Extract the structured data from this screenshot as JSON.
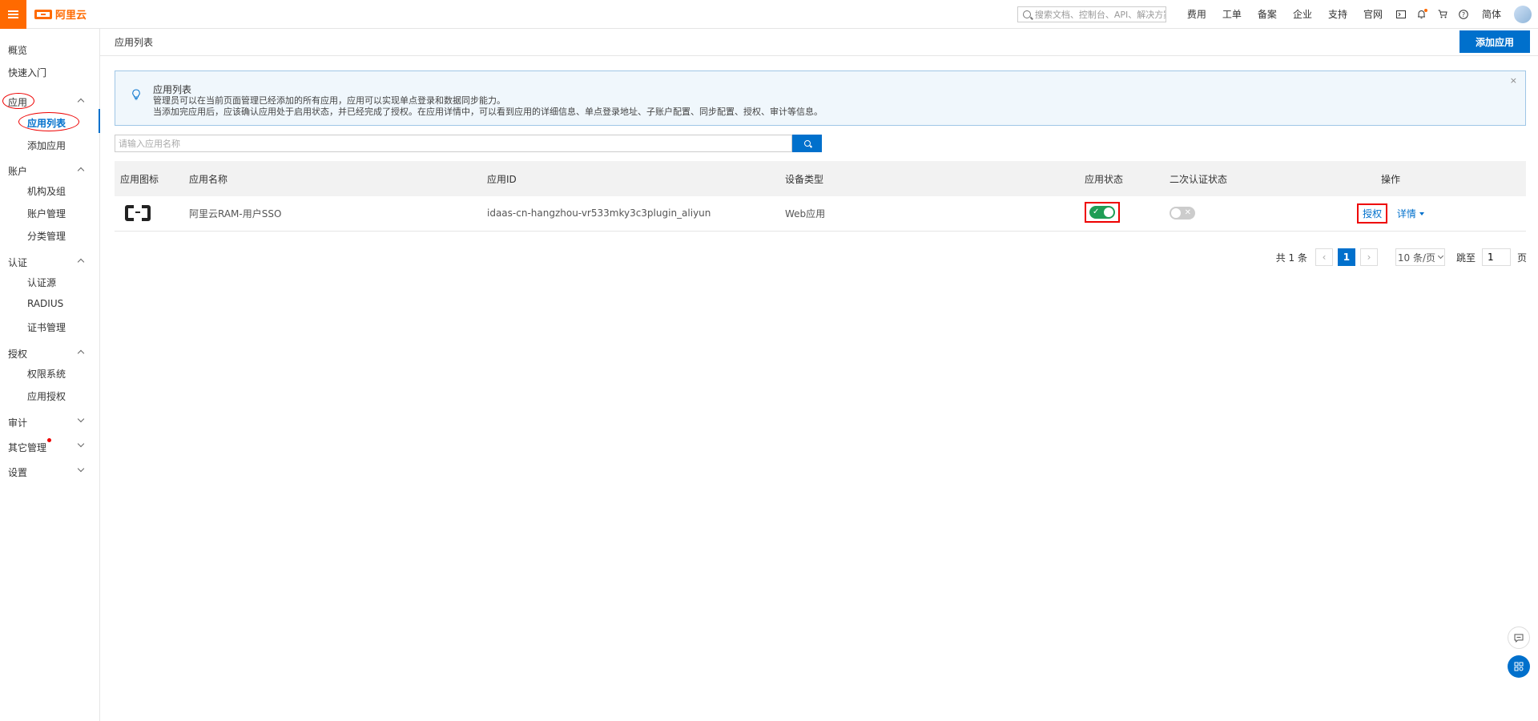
{
  "topbar": {
    "brand": "阿里云",
    "search_placeholder": "搜索文档、控制台、API、解决方案和资源",
    "links": [
      "费用",
      "工单",
      "备案",
      "企业",
      "支持",
      "官网"
    ],
    "lang": "简体"
  },
  "sidebar": {
    "overview": "概览",
    "quickstart": "快速入门",
    "app": "应用",
    "app_list": "应用列表",
    "add_app": "添加应用",
    "account": "账户",
    "org_group": "机构及组",
    "account_mgmt": "账户管理",
    "category_mgmt": "分类管理",
    "auth": "认证",
    "auth_source": "认证源",
    "radius": "RADIUS",
    "cert_mgmt": "证书管理",
    "authorize": "授权",
    "perm_system": "权限系统",
    "app_authorize": "应用授权",
    "audit": "审计",
    "other_mgmt": "其它管理",
    "settings": "设置"
  },
  "page": {
    "title": "应用列表",
    "add_button": "添加应用"
  },
  "notice": {
    "title": "应用列表",
    "line1": "管理员可以在当前页面管理已经添加的所有应用，应用可以实现单点登录和数据同步能力。",
    "line2": "当添加完应用后，应该确认应用处于启用状态，并已经完成了授权。在应用详情中，可以看到应用的详细信息、单点登录地址、子账户配置、同步配置、授权、审计等信息。",
    "close": "×"
  },
  "filter": {
    "placeholder": "请输入应用名称"
  },
  "table": {
    "headers": {
      "icon": "应用图标",
      "name": "应用名称",
      "id": "应用ID",
      "device": "设备类型",
      "status": "应用状态",
      "mfa": "二次认证状态",
      "ops": "操作"
    },
    "rows": [
      {
        "name": "阿里云RAM-用户SSO",
        "id": "idaas-cn-hangzhou-vr533mky3c3plugin_aliyun",
        "device": "Web应用",
        "status_on": true,
        "mfa_on": false,
        "op_authorize": "授权",
        "op_detail": "详情"
      }
    ]
  },
  "pagination": {
    "total": "共 1 条",
    "current": "1",
    "page_size": "10 条/页",
    "jump_label": "跳至",
    "jump_value": "1",
    "page_suffix": "页"
  },
  "colors": {
    "brand_orange": "#ff6a00",
    "primary_blue": "#0070cc",
    "toggle_on": "#1f9d55",
    "annotation_red": "#e00000"
  }
}
